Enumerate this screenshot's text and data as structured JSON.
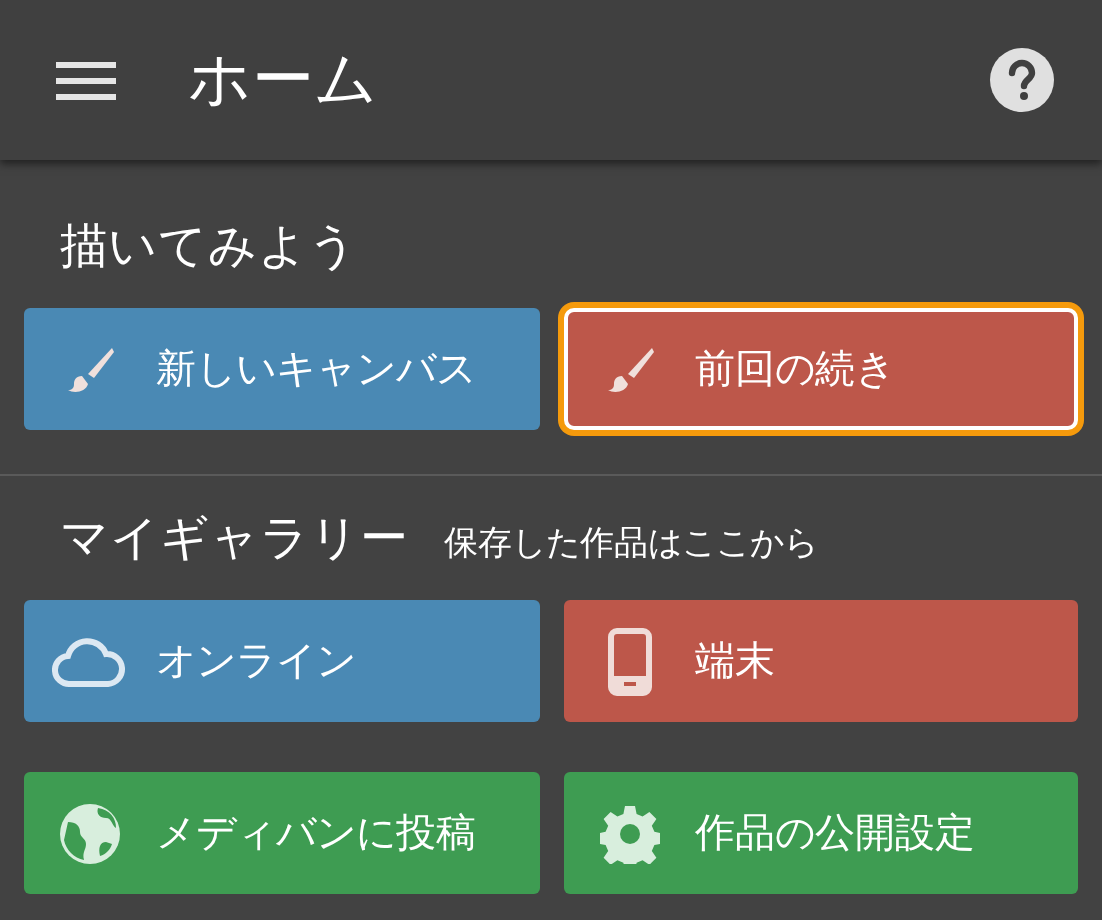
{
  "app_bar": {
    "title": "ホーム"
  },
  "sections": [
    {
      "title": "描いてみよう",
      "buttons": [
        {
          "label": "新しいキャンバス",
          "kind": "brush",
          "color": "#4a89b4",
          "focused": false
        },
        {
          "label": "前回の続き",
          "kind": "brush",
          "color": "#bd574a",
          "focused": true
        }
      ]
    },
    {
      "title": "マイギャラリー",
      "subtitle": "保存した作品はここから",
      "buttons": [
        {
          "label": "オンライン",
          "kind": "cloud",
          "color": "#4a89b4",
          "focused": false
        },
        {
          "label": "端末",
          "kind": "phone",
          "color": "#bd574a",
          "focused": false
        },
        {
          "label": "メディバンに投稿",
          "kind": "globe",
          "color": "#3e9c52",
          "focused": false
        },
        {
          "label": "作品の公開設定",
          "kind": "gear",
          "color": "#3e9c52",
          "focused": false
        }
      ]
    }
  ]
}
